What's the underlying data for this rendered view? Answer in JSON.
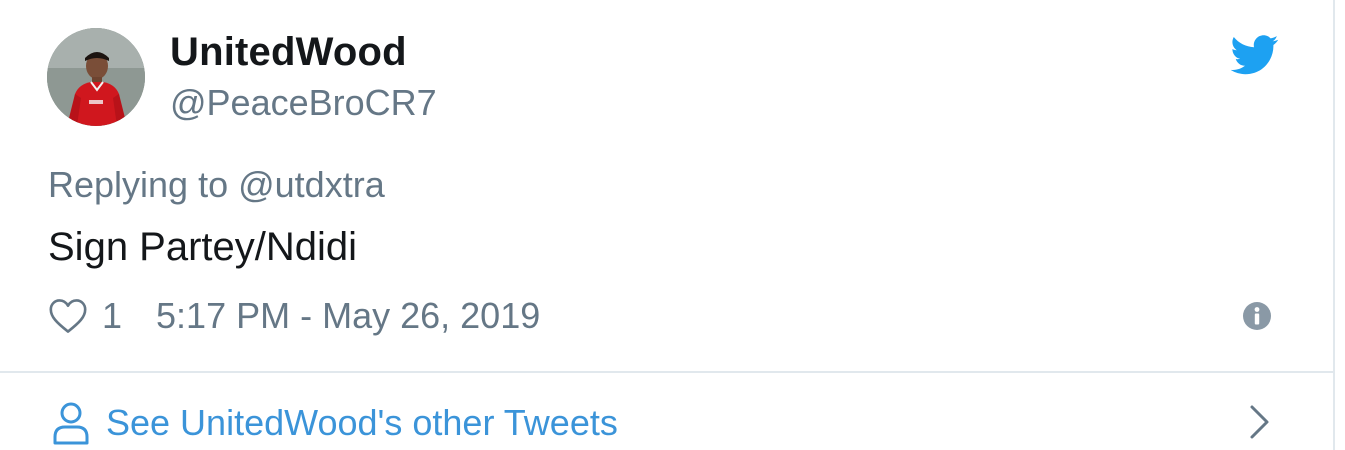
{
  "user": {
    "display_name": "UnitedWood",
    "handle": "@PeaceBroCR7",
    "avatar_icon": "profile-photo"
  },
  "tweet": {
    "replying_prefix": "Replying to ",
    "replying_to": "@utdxtra",
    "text": "Sign Partey/Ndidi",
    "like_count": "1",
    "timestamp": "5:17 PM - May 26, 2019"
  },
  "footer": {
    "other_tweets_label": "See UnitedWood's other Tweets"
  },
  "icons": {
    "brand": "twitter-bird-icon",
    "like": "heart-icon",
    "info": "info-icon",
    "profile": "person-icon",
    "navigate": "chevron-right-icon"
  },
  "colors": {
    "brand_blue": "#1da1f2",
    "link_blue": "#3b94d9",
    "secondary_text": "#657786",
    "primary_text": "#14171a",
    "border": "#e1e8ed"
  }
}
